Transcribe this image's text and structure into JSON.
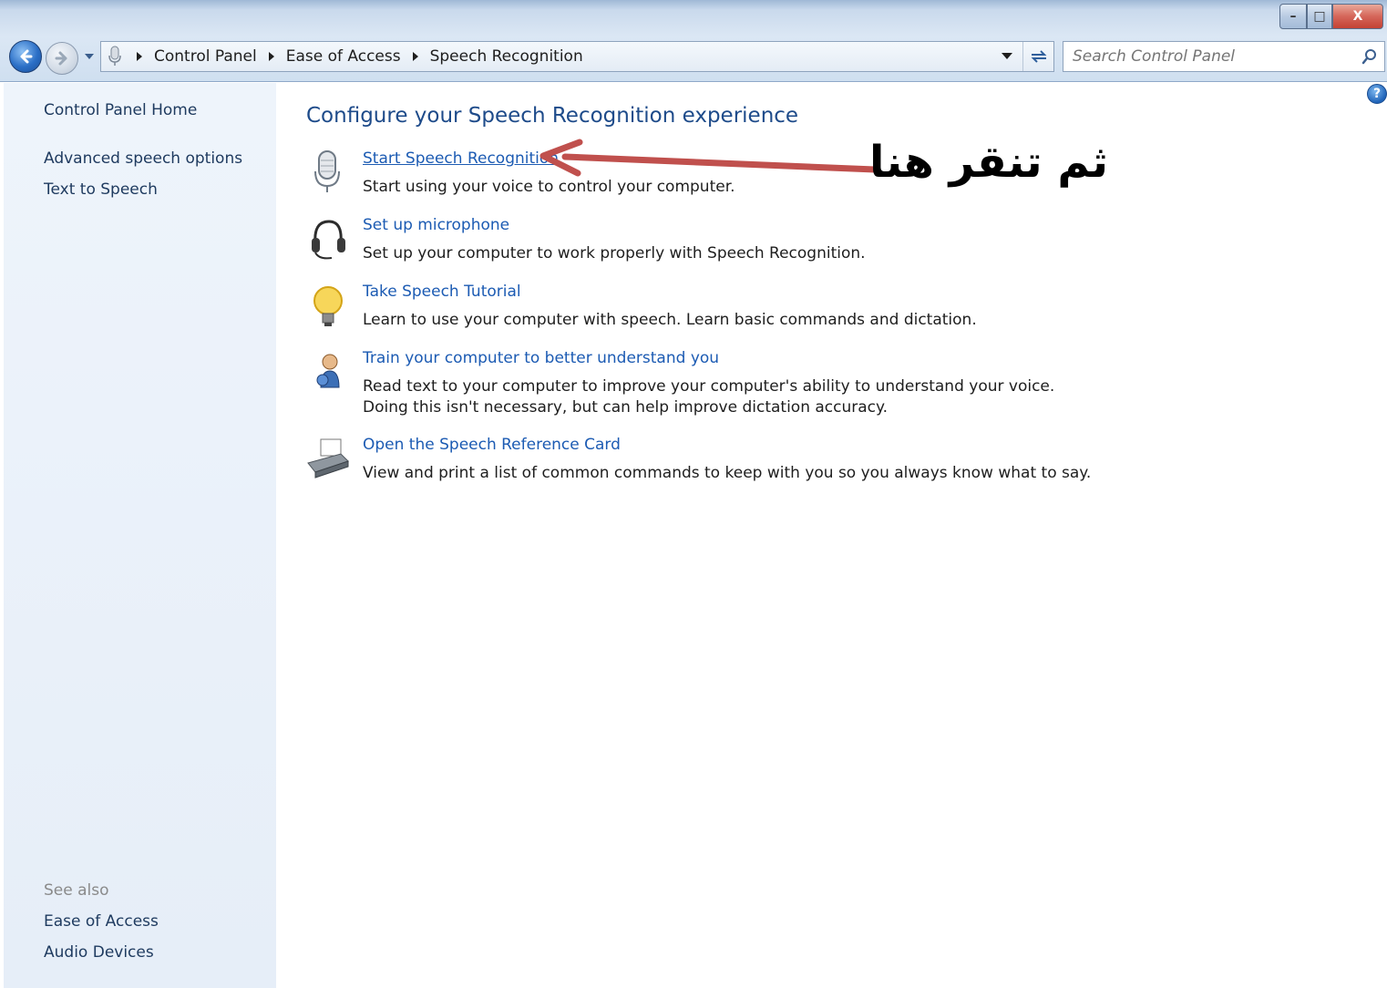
{
  "window": {
    "minimize_label": "–",
    "maximize_label": "□",
    "close_label": "X"
  },
  "address": {
    "crumbs": [
      "Control Panel",
      "Ease of Access",
      "Speech Recognition"
    ]
  },
  "search": {
    "placeholder": "Search Control Panel"
  },
  "sidebar": {
    "home": "Control Panel Home",
    "links": [
      "Advanced speech options",
      "Text to Speech"
    ],
    "see_also_heading": "See also",
    "see_also": [
      "Ease of Access",
      "Audio Devices"
    ]
  },
  "main": {
    "help_label": "?",
    "title": "Configure your Speech Recognition experience",
    "tasks": [
      {
        "icon": "microphone-icon",
        "link": "Start Speech Recognition",
        "desc": "Start using your voice to control your computer."
      },
      {
        "icon": "headset-icon",
        "link": "Set up microphone",
        "desc": "Set up your computer to work properly with Speech Recognition."
      },
      {
        "icon": "lightbulb-icon",
        "link": "Take Speech Tutorial",
        "desc": "Learn to use your computer with speech.  Learn basic commands and dictation."
      },
      {
        "icon": "user-training-icon",
        "link": "Train your computer to better understand you",
        "desc": "Read text to your computer to improve your computer's ability to understand your voice.  Doing this isn't necessary, but can help improve dictation accuracy."
      },
      {
        "icon": "printer-icon",
        "link": "Open the Speech Reference Card",
        "desc": "View and print a list of common commands to keep with you so you always know what to say."
      }
    ]
  },
  "annotation": {
    "text": "ثم تنقر هنا",
    "arrow_color": "#c0504d"
  }
}
